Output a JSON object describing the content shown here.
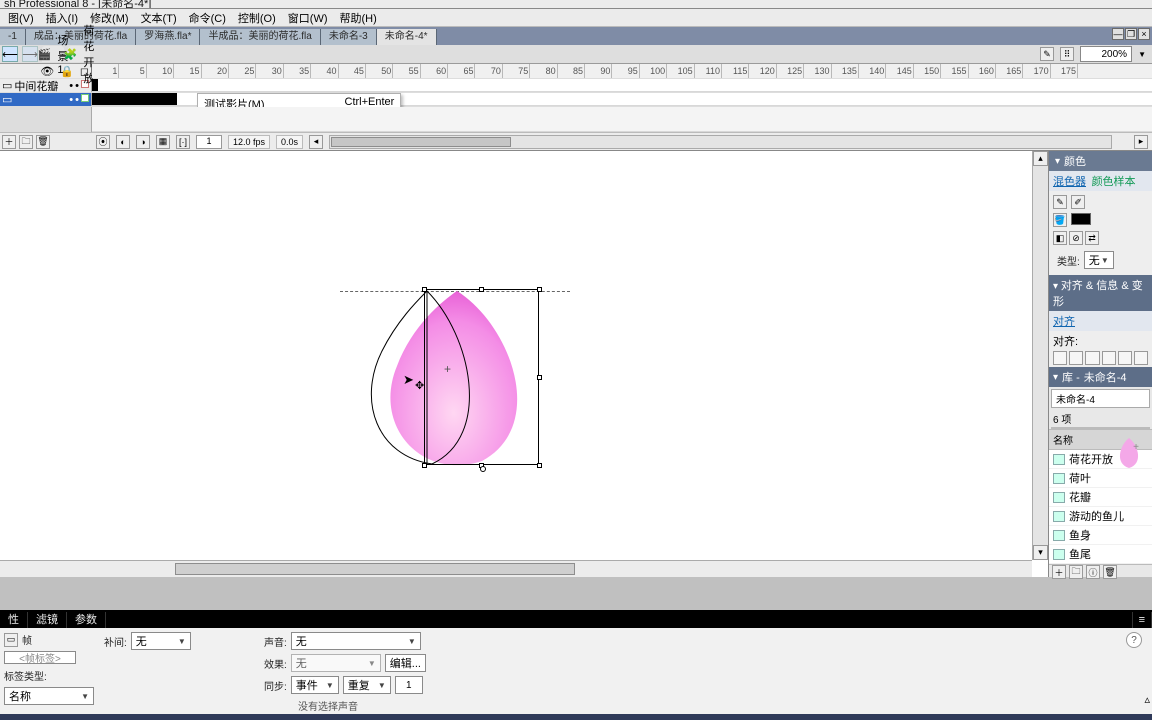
{
  "app": {
    "title": "sh Professional 8 - [未命名-4*]"
  },
  "menu": {
    "view": "图(V)",
    "insert": "插入(I)",
    "modify": "修改(M)",
    "text": "文本(T)",
    "commands": "命令(C)",
    "control": "控制(O)",
    "window": "窗口(W)",
    "help": "帮助(H)"
  },
  "doc_tabs": {
    "t0": "-1",
    "t1": "成品：美丽的荷花.fla",
    "t2": "罗海燕.fla*",
    "t3": "半成品：美丽的荷花.fla",
    "t4": "未命名-3",
    "t5": "未命名-4*"
  },
  "scene": {
    "scene_label": "场景 1",
    "symbol_label": "荷花开放",
    "zoom": "200%"
  },
  "ruler_start": 1,
  "layers": {
    "l0": "中间花瓣",
    "l1": ""
  },
  "ctx_menu": {
    "label": "测试影片(M)",
    "shortcut": "Ctrl+Enter"
  },
  "tl_status": {
    "frame": "1",
    "fps": "12.0 fps",
    "time": "0.0s"
  },
  "properties": {
    "tab_props": "性",
    "tab_filters": "滤镜",
    "tab_params": "参数",
    "frame_label": "帧",
    "label_placeholder": "<帧标签>",
    "labeltype_label": "标签类型:",
    "labeltype_value": "名称",
    "tween_label": "补间:",
    "tween_value": "无",
    "sound_label": "声音:",
    "sound_value": "无",
    "effect_label": "效果:",
    "effect_value": "无",
    "edit_btn": "编辑...",
    "sync_label": "同步:",
    "sync_value": "事件",
    "repeat_value": "重复",
    "repeat_count": "1",
    "no_sound": "没有选择声音"
  },
  "color_panel": {
    "title": "颜色",
    "tab1": "混色器",
    "tab2": "颜色样本",
    "type_label": "类型:",
    "type_value": "无"
  },
  "align_panel": {
    "title": "对齐 & 信息 & 变形",
    "tab": "对齐",
    "row_label": "对齐:"
  },
  "library": {
    "title_prefix": "库 - ",
    "doc": "未命名-4",
    "name_field": "未命名-4",
    "count": "6 项",
    "col_name": "名称",
    "items": {
      "i0": "荷花开放",
      "i1": "荷叶",
      "i2": "花瓣",
      "i3": "游动的鱼儿",
      "i4": "鱼身",
      "i5": "鱼尾"
    }
  }
}
